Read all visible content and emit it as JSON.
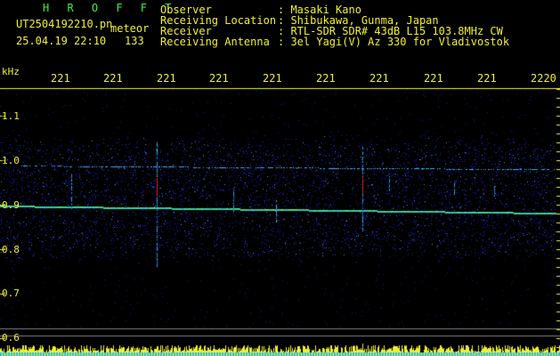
{
  "header": {
    "app_name": "H R O F F T",
    "filename": "UT2504192210.pn",
    "event_type": "meteor",
    "datetime": "25.04.19 22:10",
    "count": "133",
    "fields": [
      {
        "label": "Observer",
        "value": ": Masaki Kano"
      },
      {
        "label": "Receiving Location",
        "value": ": Shibukawa, Gunma, Japan"
      },
      {
        "label": "Receiver",
        "value": ": RTL-SDR SDR# 43dB L15 103.8MHz CW"
      },
      {
        "label": "Receiving Antenna",
        "value": ": 3el Yagi(V) Az 330 for Vladivostok"
      }
    ]
  },
  "axis": {
    "unit": "kHz",
    "y_ticks": [
      "1.1",
      "1.0",
      "0.9",
      "0.8",
      "0.7",
      "0.6"
    ],
    "x_ticks": [
      "221",
      "221",
      "221",
      "221",
      "221",
      "221",
      "221",
      "221",
      "221",
      "2220"
    ]
  },
  "colors": {
    "text_yellow": "#f0f030",
    "text_green": "#40f040",
    "background": "#000000"
  }
}
